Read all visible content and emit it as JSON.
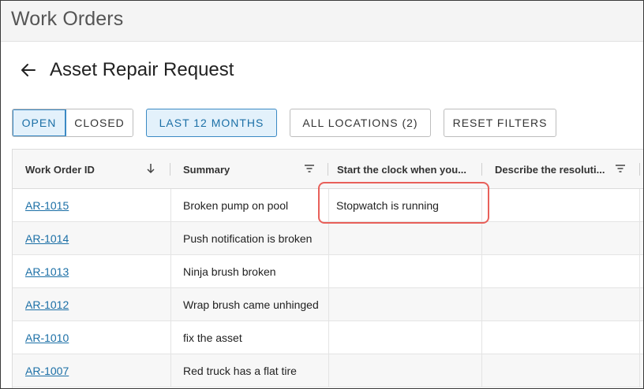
{
  "app": {
    "title": "Work Orders"
  },
  "page": {
    "title": "Asset Repair Request"
  },
  "filters": {
    "status": {
      "open": "OPEN",
      "closed": "CLOSED",
      "selected": "OPEN"
    },
    "date_range": "LAST 12 MONTHS",
    "locations": "ALL LOCATIONS (2)",
    "reset": "RESET FILTERS"
  },
  "table": {
    "columns": [
      {
        "label": "Work Order ID",
        "icon": "sort-arrow-down-icon"
      },
      {
        "label": "Summary",
        "icon": "filter-icon"
      },
      {
        "label": "Start the clock when you..."
      },
      {
        "label": "Describe the resoluti...",
        "icon": "filter-icon"
      }
    ],
    "rows": [
      {
        "id": "AR-1015",
        "summary": "Broken pump on pool",
        "clock": "Stopwatch is running",
        "resolution": ""
      },
      {
        "id": "AR-1014",
        "summary": "Push notification is broken",
        "clock": "",
        "resolution": ""
      },
      {
        "id": "AR-1013",
        "summary": "Ninja brush broken",
        "clock": "",
        "resolution": ""
      },
      {
        "id": "AR-1012",
        "summary": "Wrap brush came unhinged",
        "clock": "",
        "resolution": ""
      },
      {
        "id": "AR-1010",
        "summary": "fix the asset",
        "clock": "",
        "resolution": ""
      },
      {
        "id": "AR-1007",
        "summary": "Red truck has a flat tire",
        "clock": "",
        "resolution": ""
      }
    ]
  },
  "colors": {
    "accent": "#1b6fa6",
    "active_bg": "#e3f1fb",
    "highlight": "#e8605a"
  }
}
